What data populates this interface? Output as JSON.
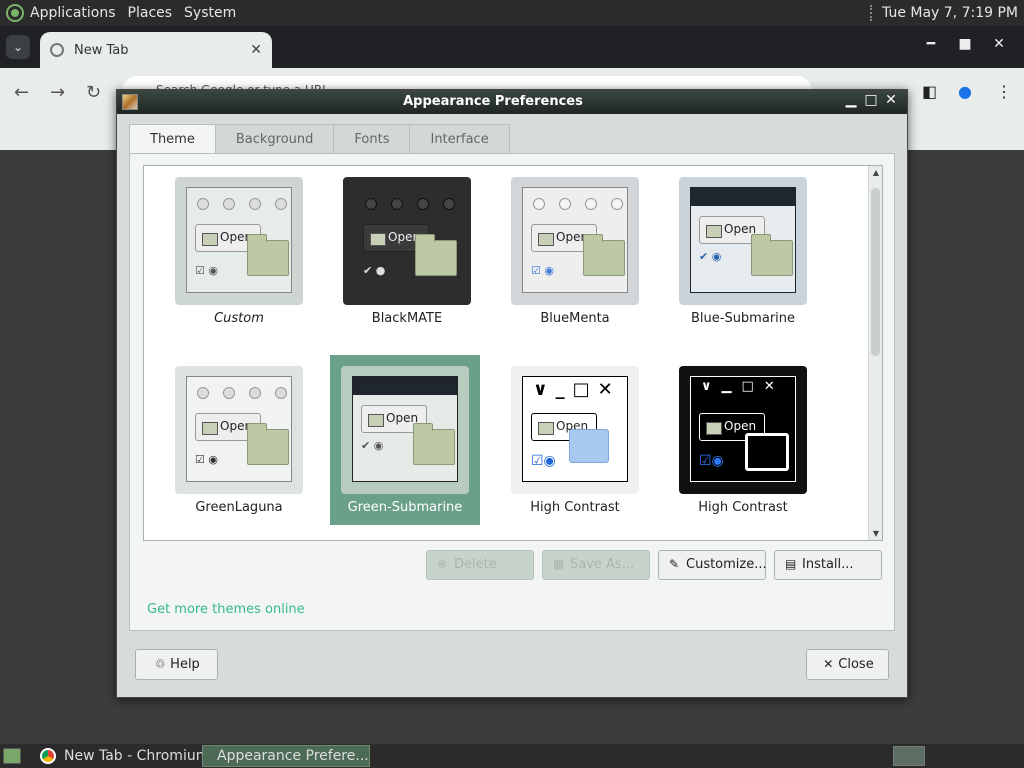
{
  "top_panel": {
    "menus": [
      "Applications",
      "Places",
      "System"
    ],
    "clock": "Tue May  7,  7:19 PM"
  },
  "browser": {
    "tab_title": "New Tab",
    "omnibox_text": "Search Google or type a URL"
  },
  "dialog": {
    "title": "Appearance Preferences",
    "tabs": [
      "Theme",
      "Background",
      "Fonts",
      "Interface"
    ],
    "themes": [
      {
        "name": "Custom",
        "style": "custom"
      },
      {
        "name": "BlackMATE",
        "style": "black"
      },
      {
        "name": "BlueMenta",
        "style": "bluementa"
      },
      {
        "name": "Blue-Submarine",
        "style": "bluesub"
      },
      {
        "name": "GreenLaguna",
        "style": "greenlaguna"
      },
      {
        "name": "Green-Submarine",
        "style": "greensub"
      },
      {
        "name": "High Contrast",
        "style": "hc"
      },
      {
        "name": "High Contrast",
        "style": "hcinv"
      }
    ],
    "selected_theme": "Green-Submarine",
    "buttons": {
      "delete": "Delete",
      "save_as": "Save As...",
      "customize": "Customize...",
      "install": "Install..."
    },
    "more_link": "Get more themes online",
    "help": "Help",
    "close": "Close",
    "preview_open_label": "Open"
  },
  "taskbar": {
    "tasks": [
      "New Tab - Chromium",
      "Appearance Prefere..."
    ]
  }
}
